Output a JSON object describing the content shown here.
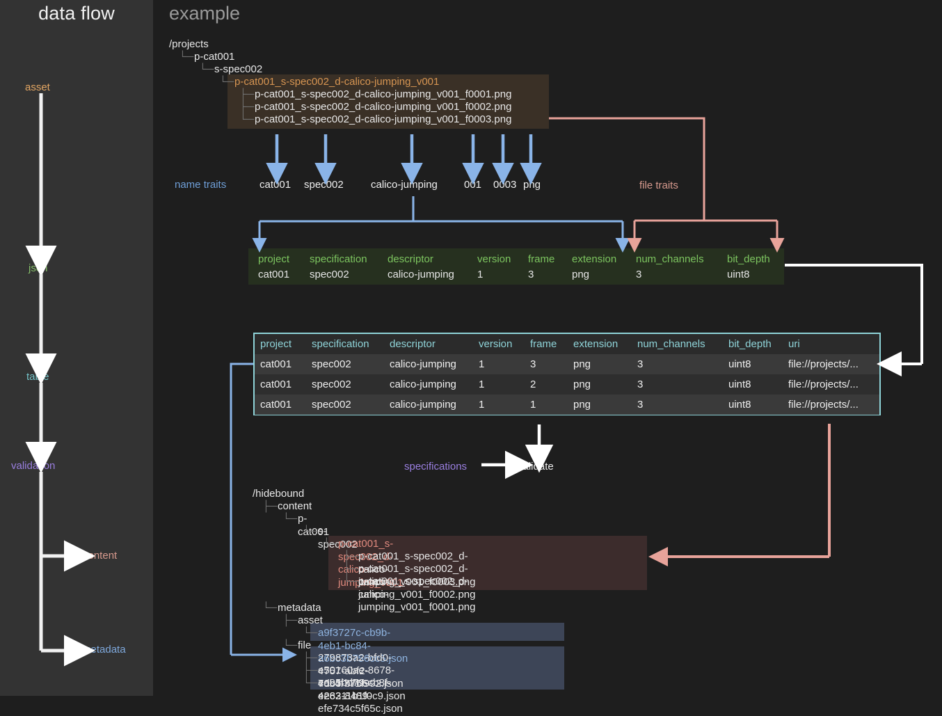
{
  "sidebar": {
    "title": "data flow",
    "steps": [
      {
        "label": "asset",
        "color": "#e3a663"
      },
      {
        "label": "json",
        "color": "#86c06a"
      },
      {
        "label": "table",
        "color": "#74c4c9"
      },
      {
        "label": "validation",
        "color": "#9a7fe0"
      }
    ],
    "outputs": [
      {
        "label": "content",
        "color": "#d79a8e"
      },
      {
        "label": "metadata",
        "color": "#7fa9dd"
      }
    ]
  },
  "main": {
    "title": "example",
    "source_tree": {
      "root": "/projects",
      "level1": "p-cat001",
      "level2": "s-spec002",
      "asset_dir": "p-cat001_s-spec002_d-calico-jumping_v001",
      "files": [
        "p-cat001_s-spec002_d-calico-jumping_v001_f0001.png",
        "p-cat001_s-spec002_d-calico-jumping_v001_f0002.png",
        "p-cat001_s-spec002_d-calico-jumping_v001_f0003.png"
      ]
    },
    "name_traits_label": "name traits",
    "name_traits": [
      "cat001",
      "spec002",
      "calico-jumping",
      "001",
      "0003",
      "png"
    ],
    "file_traits_label": "file traits",
    "json_table": {
      "headers": [
        "project",
        "specification",
        "descriptor",
        "version",
        "frame",
        "extension",
        "num_channels",
        "bit_depth"
      ],
      "values": [
        "cat001",
        "spec002",
        "calico-jumping",
        "1",
        "3",
        "png",
        "3",
        "uint8"
      ]
    },
    "data_table": {
      "headers": [
        "project",
        "specification",
        "descriptor",
        "version",
        "frame",
        "extension",
        "num_channels",
        "bit_depth",
        "uri"
      ],
      "rows": [
        [
          "cat001",
          "spec002",
          "calico-jumping",
          "1",
          "3",
          "png",
          "3",
          "uint8",
          "file://projects/..."
        ],
        [
          "cat001",
          "spec002",
          "calico-jumping",
          "1",
          "2",
          "png",
          "3",
          "uint8",
          "file://projects/..."
        ],
        [
          "cat001",
          "spec002",
          "calico-jumping",
          "1",
          "1",
          "png",
          "3",
          "uint8",
          "file://projects/..."
        ]
      ]
    },
    "validation": {
      "specifications_label": "specifications",
      "validate_label": "validate"
    },
    "output_tree": {
      "root": "/hidebound",
      "content": "content",
      "content_level1": "p-cat001",
      "content_level2": "s-spec002",
      "asset_dir": "p-cat001_s-spec002_d-calico-jumping_v001",
      "content_files": [
        "p-cat001_s-spec002_d-calico-jumping_v001_f0003.png",
        "p-cat001_s-spec002_d-calico-jumping_v001_f0002.png",
        "p-cat001_s-spec002_d-calico-jumping_v001_f0001.png"
      ],
      "metadata": "metadata",
      "metadata_asset": "asset",
      "asset_json": [
        "a9f3727c-cb9b-4eb1-bc84-a6bc3b756cc5.json"
      ],
      "metadata_file": "file",
      "file_json": [
        "279873a2-bfd0-4757-abf2-7dc4f771f992.json",
        "e50160ae-8678-40b3-b766-ee8311b1f0c9.json",
        "ea95bd79-cb8f-4262-8489-efe734c5f65c.json"
      ]
    }
  },
  "colors": {
    "background": "#1e1e1e",
    "sidebar_bg": "#333333",
    "name_trait_arrow": "#8ab4e8",
    "file_trait_arrow": "#e8a39a",
    "table_border": "#8fd4d9",
    "json_header": "#7cc45f",
    "white_arrow": "#ffffff"
  }
}
